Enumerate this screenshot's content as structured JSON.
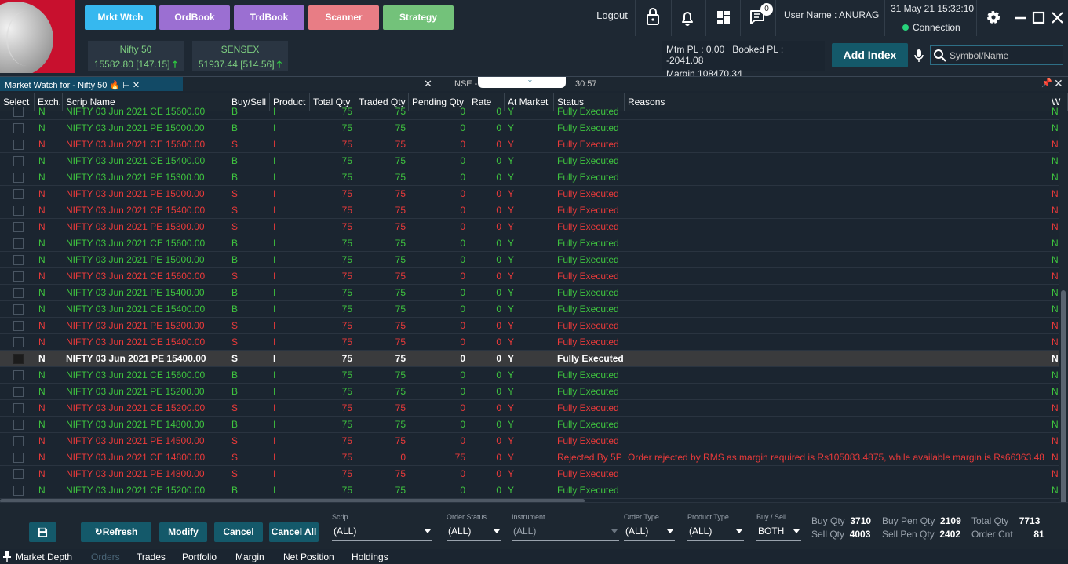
{
  "nav": {
    "mrkt_watch": "Mrkt Wtch",
    "ord_book": "OrdBook",
    "trd_book": "TrdBook",
    "scanner": "Scanner",
    "strategy": "Strategy"
  },
  "header": {
    "logout": "Logout",
    "notification_count": "0",
    "username": "User Name : ANURAG",
    "datetime": "31 May 21 15:32:10",
    "connection": "Connection"
  },
  "indices": [
    {
      "name": "Nifty 50",
      "value": "15582.80 [147.15]"
    },
    {
      "name": "SENSEX",
      "value": "51937.44 [514.56]"
    }
  ],
  "pl": {
    "mtm": "Mtm PL : 0.00",
    "booked": "Booked PL : -2041.08",
    "margin": "Margin  108470.34"
  },
  "add_index": "Add Index",
  "search": {
    "placeholder": "Symbol/Name"
  },
  "tabs": {
    "market_watch": "Market Watch for  -  Nifty 50",
    "nse": "NSE - ",
    "nse_time": "30:57"
  },
  "columns": [
    "Select",
    "Exch.",
    "Scrip Name",
    "Buy/Sell",
    "Product",
    "Total Qty",
    "Traded Qty",
    "Pending Qty",
    "Rate",
    "At Market",
    "Status",
    "Reasons",
    "W"
  ],
  "orders": [
    {
      "exch": "N",
      "scrip": "NIFTY 03 Jun 2021 CE 15600.00",
      "side": "B",
      "product": "I",
      "total": "75",
      "traded": "75",
      "pending": "0",
      "rate": "0",
      "at_market": "Y",
      "status": "Fully Executed",
      "reason": "",
      "w": "N"
    },
    {
      "exch": "N",
      "scrip": "NIFTY 03 Jun 2021 PE 15000.00",
      "side": "B",
      "product": "I",
      "total": "75",
      "traded": "75",
      "pending": "0",
      "rate": "0",
      "at_market": "Y",
      "status": "Fully Executed",
      "reason": "",
      "w": "N"
    },
    {
      "exch": "N",
      "scrip": "NIFTY 03 Jun 2021 CE 15600.00",
      "side": "S",
      "product": "I",
      "total": "75",
      "traded": "75",
      "pending": "0",
      "rate": "0",
      "at_market": "Y",
      "status": "Fully Executed",
      "reason": "",
      "w": "N"
    },
    {
      "exch": "N",
      "scrip": "NIFTY 03 Jun 2021 CE 15400.00",
      "side": "B",
      "product": "I",
      "total": "75",
      "traded": "75",
      "pending": "0",
      "rate": "0",
      "at_market": "Y",
      "status": "Fully Executed",
      "reason": "",
      "w": "N"
    },
    {
      "exch": "N",
      "scrip": "NIFTY 03 Jun 2021 PE 15300.00",
      "side": "B",
      "product": "I",
      "total": "75",
      "traded": "75",
      "pending": "0",
      "rate": "0",
      "at_market": "Y",
      "status": "Fully Executed",
      "reason": "",
      "w": "N"
    },
    {
      "exch": "N",
      "scrip": "NIFTY 03 Jun 2021 PE 15000.00",
      "side": "S",
      "product": "I",
      "total": "75",
      "traded": "75",
      "pending": "0",
      "rate": "0",
      "at_market": "Y",
      "status": "Fully Executed",
      "reason": "",
      "w": "N"
    },
    {
      "exch": "N",
      "scrip": "NIFTY 03 Jun 2021 CE 15400.00",
      "side": "S",
      "product": "I",
      "total": "75",
      "traded": "75",
      "pending": "0",
      "rate": "0",
      "at_market": "Y",
      "status": "Fully Executed",
      "reason": "",
      "w": "N"
    },
    {
      "exch": "N",
      "scrip": "NIFTY 03 Jun 2021 PE 15300.00",
      "side": "S",
      "product": "I",
      "total": "75",
      "traded": "75",
      "pending": "0",
      "rate": "0",
      "at_market": "Y",
      "status": "Fully Executed",
      "reason": "",
      "w": "N"
    },
    {
      "exch": "N",
      "scrip": "NIFTY 03 Jun 2021 CE 15600.00",
      "side": "B",
      "product": "I",
      "total": "75",
      "traded": "75",
      "pending": "0",
      "rate": "0",
      "at_market": "Y",
      "status": "Fully Executed",
      "reason": "",
      "w": "N"
    },
    {
      "exch": "N",
      "scrip": "NIFTY 03 Jun 2021 PE 15000.00",
      "side": "B",
      "product": "I",
      "total": "75",
      "traded": "75",
      "pending": "0",
      "rate": "0",
      "at_market": "Y",
      "status": "Fully Executed",
      "reason": "",
      "w": "N"
    },
    {
      "exch": "N",
      "scrip": "NIFTY 03 Jun 2021 CE 15600.00",
      "side": "S",
      "product": "I",
      "total": "75",
      "traded": "75",
      "pending": "0",
      "rate": "0",
      "at_market": "Y",
      "status": "Fully Executed",
      "reason": "",
      "w": "N"
    },
    {
      "exch": "N",
      "scrip": "NIFTY 03 Jun 2021 PE 15400.00",
      "side": "B",
      "product": "I",
      "total": "75",
      "traded": "75",
      "pending": "0",
      "rate": "0",
      "at_market": "Y",
      "status": "Fully Executed",
      "reason": "",
      "w": "N"
    },
    {
      "exch": "N",
      "scrip": "NIFTY 03 Jun 2021 CE 15400.00",
      "side": "B",
      "product": "I",
      "total": "75",
      "traded": "75",
      "pending": "0",
      "rate": "0",
      "at_market": "Y",
      "status": "Fully Executed",
      "reason": "",
      "w": "N"
    },
    {
      "exch": "N",
      "scrip": "NIFTY 03 Jun 2021 PE 15200.00",
      "side": "S",
      "product": "I",
      "total": "75",
      "traded": "75",
      "pending": "0",
      "rate": "0",
      "at_market": "Y",
      "status": "Fully Executed",
      "reason": "",
      "w": "N"
    },
    {
      "exch": "N",
      "scrip": "NIFTY 03 Jun 2021 CE 15400.00",
      "side": "S",
      "product": "I",
      "total": "75",
      "traded": "75",
      "pending": "0",
      "rate": "0",
      "at_market": "Y",
      "status": "Fully Executed",
      "reason": "",
      "w": "N"
    },
    {
      "exch": "N",
      "scrip": "NIFTY 03 Jun 2021 PE 15400.00",
      "side": "S",
      "product": "I",
      "total": "75",
      "traded": "75",
      "pending": "0",
      "rate": "0",
      "at_market": "Y",
      "status": "Fully Executed",
      "reason": "",
      "w": "N",
      "selected": true
    },
    {
      "exch": "N",
      "scrip": "NIFTY 03 Jun 2021 CE 15600.00",
      "side": "B",
      "product": "I",
      "total": "75",
      "traded": "75",
      "pending": "0",
      "rate": "0",
      "at_market": "Y",
      "status": "Fully Executed",
      "reason": "",
      "w": "N"
    },
    {
      "exch": "N",
      "scrip": "NIFTY 03 Jun 2021 PE 15200.00",
      "side": "B",
      "product": "I",
      "total": "75",
      "traded": "75",
      "pending": "0",
      "rate": "0",
      "at_market": "Y",
      "status": "Fully Executed",
      "reason": "",
      "w": "N"
    },
    {
      "exch": "N",
      "scrip": "NIFTY 03 Jun 2021 CE 15200.00",
      "side": "S",
      "product": "I",
      "total": "75",
      "traded": "75",
      "pending": "0",
      "rate": "0",
      "at_market": "Y",
      "status": "Fully Executed",
      "reason": "",
      "w": "N"
    },
    {
      "exch": "N",
      "scrip": "NIFTY 03 Jun 2021 PE 14800.00",
      "side": "B",
      "product": "I",
      "total": "75",
      "traded": "75",
      "pending": "0",
      "rate": "0",
      "at_market": "Y",
      "status": "Fully Executed",
      "reason": "",
      "w": "N"
    },
    {
      "exch": "N",
      "scrip": "NIFTY 03 Jun 2021 PE 14500.00",
      "side": "S",
      "product": "I",
      "total": "75",
      "traded": "75",
      "pending": "0",
      "rate": "0",
      "at_market": "Y",
      "status": "Fully Executed",
      "reason": "",
      "w": "N"
    },
    {
      "exch": "N",
      "scrip": "NIFTY 03 Jun 2021 CE 14800.00",
      "side": "S",
      "product": "I",
      "total": "75",
      "traded": "0",
      "pending": "75",
      "rate": "0",
      "at_market": "Y",
      "status": "Rejected By 5P",
      "reason": "Order rejected by RMS as margin required is Rs105083.4875, while available margin is Rs66363.48",
      "w": "N"
    },
    {
      "exch": "N",
      "scrip": "NIFTY 03 Jun 2021 PE 14800.00",
      "side": "S",
      "product": "I",
      "total": "75",
      "traded": "75",
      "pending": "0",
      "rate": "0",
      "at_market": "Y",
      "status": "Fully Executed",
      "reason": "",
      "w": "N"
    },
    {
      "exch": "N",
      "scrip": "NIFTY 03 Jun 2021 CE 15200.00",
      "side": "B",
      "product": "I",
      "total": "75",
      "traded": "75",
      "pending": "0",
      "rate": "0",
      "at_market": "Y",
      "status": "Fully Executed",
      "reason": "",
      "w": "N"
    }
  ],
  "toolbar": {
    "refresh": "Refresh",
    "modify": "Modify",
    "cancel": "Cancel",
    "cancel_all": "Cancel All"
  },
  "filters": {
    "scrip": {
      "label": "Scrip",
      "value": "(ALL)"
    },
    "order_status": {
      "label": "Order Status",
      "value": "(ALL)"
    },
    "instrument": {
      "label": "Instrument",
      "value": "(ALL)"
    },
    "order_type": {
      "label": "Order Type",
      "value": "(ALL)"
    },
    "product_type": {
      "label": "Product Type",
      "value": "(ALL)"
    },
    "buy_sell": {
      "label": "Buy / Sell",
      "value": "BOTH"
    }
  },
  "summary": {
    "buy_qty_label": "Buy Qty",
    "buy_qty": "3710",
    "sell_qty_label": "Sell Qty",
    "sell_qty": "4003",
    "buy_pen_label": "Buy Pen Qty",
    "buy_pen": "2109",
    "sell_pen_label": "Sell Pen Qty",
    "sell_pen": "2402",
    "total_qty_label": "Total Qty",
    "total_qty": "7713",
    "order_cnt_label": "Order Cnt",
    "order_cnt": "81"
  },
  "footer_tabs": [
    "Market Depth",
    "Orders",
    "Trades",
    "Portfolio",
    "Margin",
    "Net Position",
    "Holdings"
  ],
  "colors": {
    "buy": "#3fc43f",
    "sell": "#ea3a3a",
    "accent": "#14596a"
  }
}
